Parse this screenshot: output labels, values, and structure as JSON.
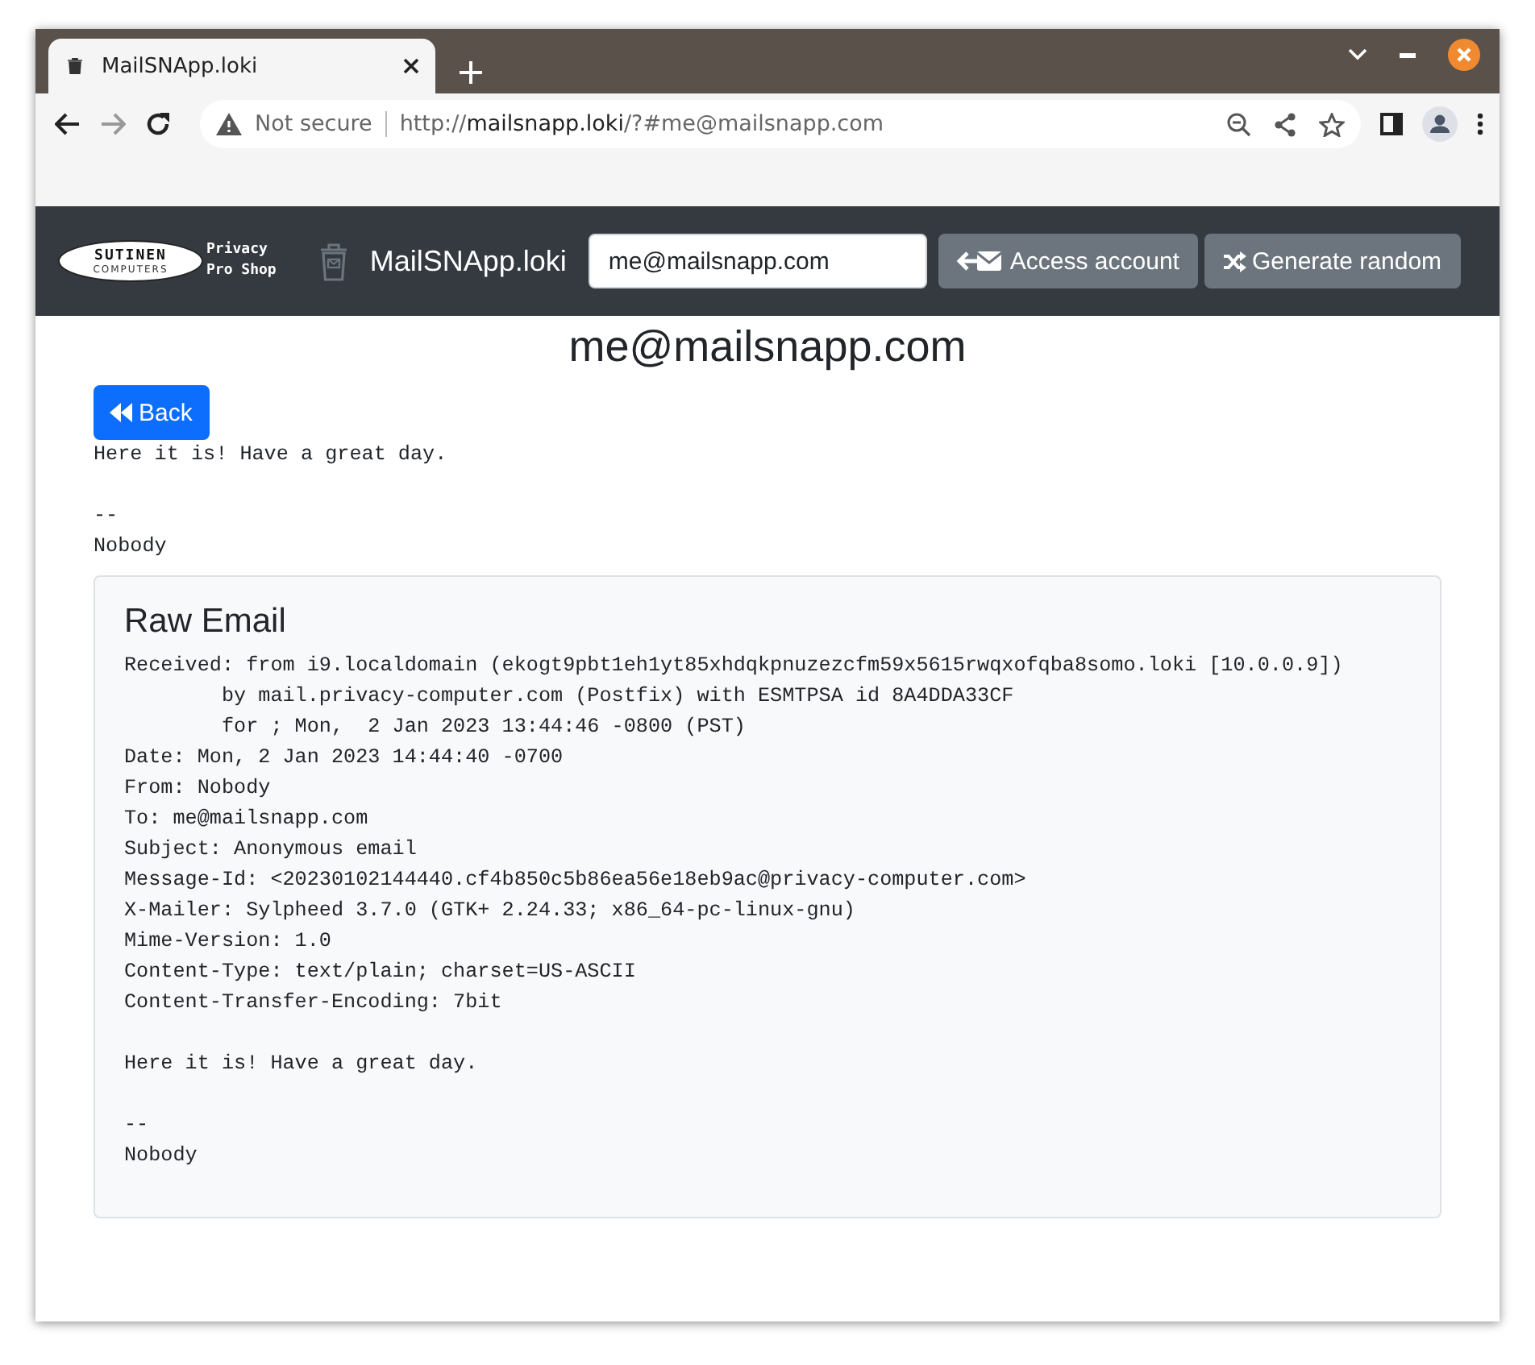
{
  "browser": {
    "tab": {
      "title": "MailSNApp.loki",
      "selected": true
    },
    "address_bar": {
      "security": "Not secure",
      "url_scheme": "http://",
      "url_host": "mailsnapp.loki",
      "url_rest": "/?#me@mailsnapp.com"
    }
  },
  "navbar": {
    "logo": {
      "name": "SUTINEN",
      "sub": "COMPUTERS",
      "tagline_1": "Privacy",
      "tagline_2": "Pro Shop"
    },
    "brand": "MailSNApp.loki",
    "email_field": {
      "value": "me@mailsnapp.com"
    },
    "buttons": [
      {
        "label": "Access account",
        "kind": "access"
      },
      {
        "label": "Generate random",
        "kind": "random"
      }
    ]
  },
  "heading": "me@mailsnapp.com",
  "back_button": "Back",
  "message_paragraphs": [
    [
      "Here it is! Have a great day."
    ],
    [
      "--",
      "Nobody"
    ]
  ],
  "raw_email": {
    "title": "Raw Email",
    "paragraphs": [
      [
        "Received: from i9.localdomain (ekogt9pbt1eh1yt85xhdqkpnuzezcfm59x5615rwqxofqba8somo.loki [10.0.0.9])",
        "        by mail.privacy-computer.com (Postfix) with ESMTPSA id 8A4DDA33CF",
        "        for ; Mon,  2 Jan 2023 13:44:46 -0800 (PST)",
        "Date: Mon, 2 Jan 2023 14:44:40 -0700",
        "From: Nobody",
        "To: me@mailsnapp.com",
        "Subject: Anonymous email",
        "Message-Id: <20230102144440.cf4b850c5b86ea56e18eb9ac@privacy-computer.com>",
        "X-Mailer: Sylpheed 3.7.0 (GTK+ 2.24.33; x86_64-pc-linux-gnu)",
        "Mime-Version: 1.0",
        "Content-Type: text/plain; charset=US-ASCII",
        "Content-Transfer-Encoding: 7bit"
      ],
      [
        "Here it is! Have a great day."
      ],
      [
        "--",
        "Nobody"
      ]
    ]
  }
}
